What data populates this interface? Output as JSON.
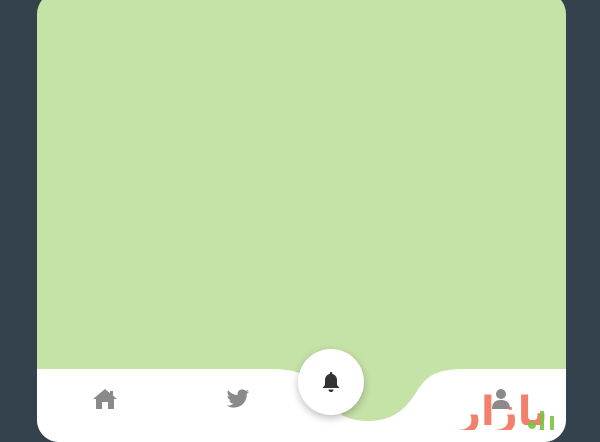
{
  "theme": {
    "background": "#34424d",
    "content_area": "#c5e2a7",
    "nav_bar": "#ffffff",
    "icon_inactive": "#8a8a8a",
    "icon_active": "#333333"
  },
  "bottom_nav": {
    "items": [
      {
        "icon": "home-icon",
        "active": false
      },
      {
        "icon": "twitter-icon",
        "active": false
      },
      {
        "icon": "bell-icon",
        "active": true
      },
      {
        "icon": "user-icon",
        "active": false
      }
    ]
  },
  "watermark": {
    "text": "بازار"
  }
}
